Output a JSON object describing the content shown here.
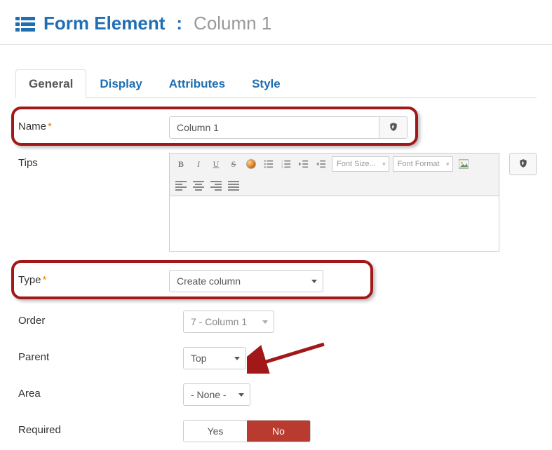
{
  "header": {
    "title": "Form Element",
    "separator": ":",
    "subtitle": "Column 1"
  },
  "tabs": [
    {
      "label": "General",
      "active": true
    },
    {
      "label": "Display",
      "active": false
    },
    {
      "label": "Attributes",
      "active": false
    },
    {
      "label": "Style",
      "active": false
    }
  ],
  "fields": {
    "name": {
      "label": "Name",
      "value": "Column 1",
      "required": true
    },
    "tips": {
      "label": "Tips"
    },
    "type": {
      "label": "Type",
      "value": "Create column",
      "required": true
    },
    "order": {
      "label": "Order",
      "value": "7 - Column 1"
    },
    "parent": {
      "label": "Parent",
      "value": "Top"
    },
    "area": {
      "label": "Area",
      "value": "- None -"
    },
    "required": {
      "label": "Required",
      "yes": "Yes",
      "no": "No"
    }
  },
  "editor_toolbar": {
    "bold": "B",
    "italic": "I",
    "underline": "U",
    "strike": "S",
    "font_size": "Font Size...",
    "font_format": "Font Format"
  }
}
